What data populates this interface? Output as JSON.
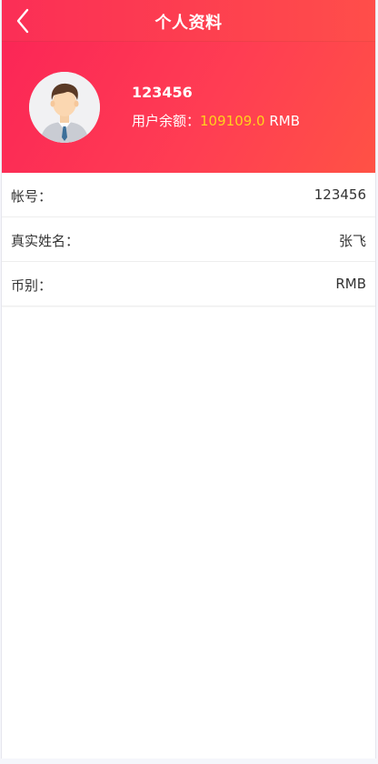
{
  "header": {
    "title": "个人资料",
    "back_icon": "chevron-left-icon"
  },
  "profile": {
    "avatar_icon": "user-avatar-icon",
    "username": "123456",
    "balance_label": "用户余额：",
    "balance_value": "109109.0",
    "balance_unit": "RMB",
    "colors": {
      "header_gradient_start": "#fb2e56",
      "header_gradient_end": "#ff4e4a",
      "balance_value": "#ffd21c"
    }
  },
  "rows": [
    {
      "label": "帐号：",
      "value": "123456"
    },
    {
      "label": "真实姓名：",
      "value": "张飞"
    },
    {
      "label": "币别：",
      "value": "RMB"
    }
  ]
}
